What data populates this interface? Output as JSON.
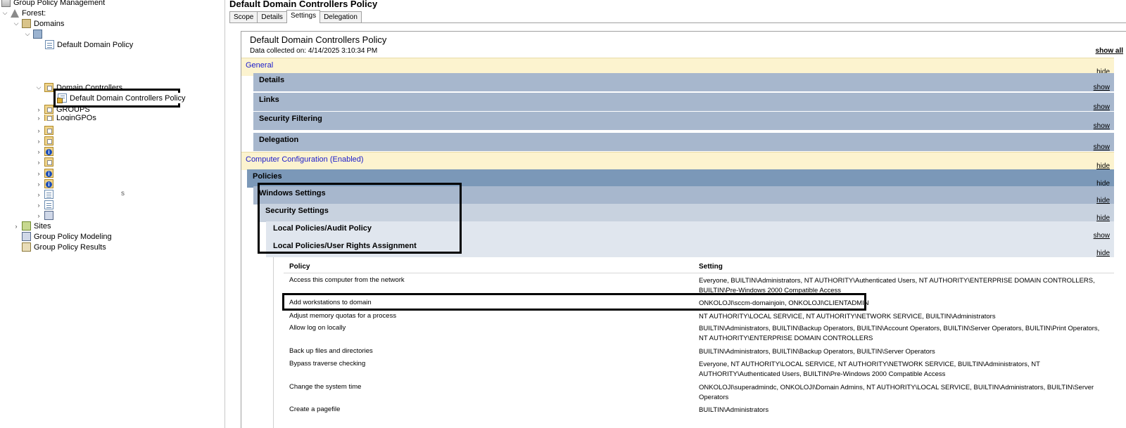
{
  "tree": {
    "root": "Group Policy Management",
    "forest": "Forest:",
    "domains": "Domains",
    "default_domain_policy": "Default Domain Policy",
    "domain_controllers": "Domain Controllers",
    "default_dc_policy": "Default Domain Controllers Policy",
    "groups": "GROUPS",
    "logon_gpos": "LoginGPOs",
    "sites": "Sites",
    "modeling": "Group Policy Modeling",
    "results": "Group Policy Results",
    "stray_char": "s"
  },
  "right": {
    "title": "Default Domain Controllers Policy",
    "tabs": [
      "Scope",
      "Details",
      "Settings",
      "Delegation"
    ],
    "active_tab": "Settings"
  },
  "report": {
    "title": "Default Domain Controllers Policy",
    "date": "Data collected on: 4/14/2025 3:10:34 PM",
    "show_all": "show all",
    "sections": {
      "general": {
        "label": "General",
        "action": "hide"
      },
      "details": {
        "label": "Details",
        "action": "show"
      },
      "links": {
        "label": "Links",
        "action": "show"
      },
      "security_filtering": {
        "label": "Security Filtering",
        "action": "show"
      },
      "delegation": {
        "label": "Delegation",
        "action": "show"
      },
      "computer_config": {
        "label": "Computer Configuration (Enabled)",
        "action": "hide"
      },
      "policies": {
        "label": "Policies",
        "action": "hide"
      },
      "windows_settings": {
        "label": "Windows Settings",
        "action": "hide"
      },
      "security_settings": {
        "label": "Security Settings",
        "action": "hide"
      },
      "audit_policy": {
        "label": "Local Policies/Audit Policy",
        "action": "show"
      },
      "user_rights": {
        "label": "Local Policies/User Rights Assignment",
        "action": "hide"
      }
    },
    "table": {
      "col_policy": "Policy",
      "col_setting": "Setting",
      "rows": [
        {
          "policy": "Access this computer from the network",
          "setting": "Everyone, BUILTIN\\Administrators, NT AUTHORITY\\Authenticated Users, NT AUTHORITY\\ENTERPRISE DOMAIN CONTROLLERS, BUILTIN\\Pre-Windows 2000 Compatible Access"
        },
        {
          "policy": "Add workstations to domain",
          "setting": "ONKOLOJI\\sccm-domainjoin, ONKOLOJI\\CLIENTADMIN"
        },
        {
          "policy": "Adjust memory quotas for a process",
          "setting": "NT AUTHORITY\\LOCAL SERVICE, NT AUTHORITY\\NETWORK SERVICE, BUILTIN\\Administrators"
        },
        {
          "policy": "Allow log on locally",
          "setting": "BUILTIN\\Administrators, BUILTIN\\Backup Operators, BUILTIN\\Account Operators, BUILTIN\\Server Operators, BUILTIN\\Print Operators, NT AUTHORITY\\ENTERPRISE DOMAIN CONTROLLERS"
        },
        {
          "policy": "Back up files and directories",
          "setting": "BUILTIN\\Administrators, BUILTIN\\Backup Operators, BUILTIN\\Server Operators"
        },
        {
          "policy": "Bypass traverse checking",
          "setting": "Everyone, NT AUTHORITY\\LOCAL SERVICE, NT AUTHORITY\\NETWORK SERVICE, BUILTIN\\Administrators, NT AUTHORITY\\Authenticated Users, BUILTIN\\Pre-Windows 2000 Compatible Access"
        },
        {
          "policy": "Change the system time",
          "setting": "ONKOLOJI\\superadmindc, ONKOLOJI\\Domain Admins, NT AUTHORITY\\LOCAL SERVICE, BUILTIN\\Administrators, BUILTIN\\Server Operators"
        },
        {
          "policy": "Create a pagefile",
          "setting": "BUILTIN\\Administrators"
        }
      ]
    }
  }
}
